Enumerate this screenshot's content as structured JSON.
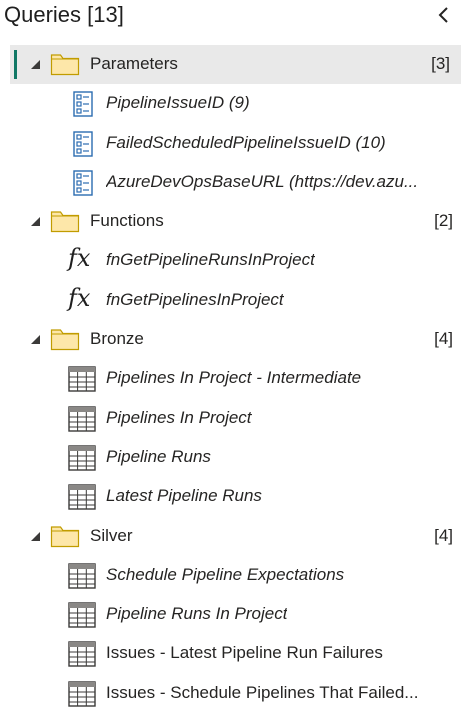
{
  "header": {
    "title": "Queries [13]",
    "collapse_icon": "chevron-left-icon"
  },
  "colors": {
    "selection_bar": "#117865",
    "selected_row_bg": "#e9e9e9",
    "folder_fill": "#fde7a9",
    "folder_stroke": "#c19c00"
  },
  "groups": [
    {
      "label": "Parameters",
      "count": "[3]",
      "selected": true,
      "items": [
        {
          "label": "PipelineIssueID (9)",
          "icon": "parameter-icon",
          "italic": true
        },
        {
          "label": "FailedScheduledPipelineIssueID (10)",
          "icon": "parameter-icon",
          "italic": true
        },
        {
          "label": "AzureDevOpsBaseURL (https://dev.azu...",
          "icon": "parameter-icon",
          "italic": true
        }
      ]
    },
    {
      "label": "Functions",
      "count": "[2]",
      "selected": false,
      "items": [
        {
          "label": "fnGetPipelineRunsInProject",
          "icon": "function-icon",
          "italic": true
        },
        {
          "label": "fnGetPipelinesInProject",
          "icon": "function-icon",
          "italic": true
        }
      ]
    },
    {
      "label": "Bronze",
      "count": "[4]",
      "selected": false,
      "items": [
        {
          "label": "Pipelines In Project - Intermediate",
          "icon": "table-icon",
          "italic": true
        },
        {
          "label": "Pipelines In Project",
          "icon": "table-icon",
          "italic": true
        },
        {
          "label": "Pipeline Runs",
          "icon": "table-icon",
          "italic": true
        },
        {
          "label": "Latest Pipeline Runs",
          "icon": "table-icon",
          "italic": true
        }
      ]
    },
    {
      "label": "Silver",
      "count": "[4]",
      "selected": false,
      "items": [
        {
          "label": "Schedule Pipeline Expectations",
          "icon": "table-icon",
          "italic": true
        },
        {
          "label": "Pipeline Runs In Project",
          "icon": "table-icon",
          "italic": true
        },
        {
          "label": "Issues - Latest Pipeline Run Failures",
          "icon": "table-icon",
          "italic": false
        },
        {
          "label": "Issues - Schedule Pipelines That Failed...",
          "icon": "table-icon",
          "italic": false
        }
      ]
    }
  ],
  "function_glyph": "fx"
}
